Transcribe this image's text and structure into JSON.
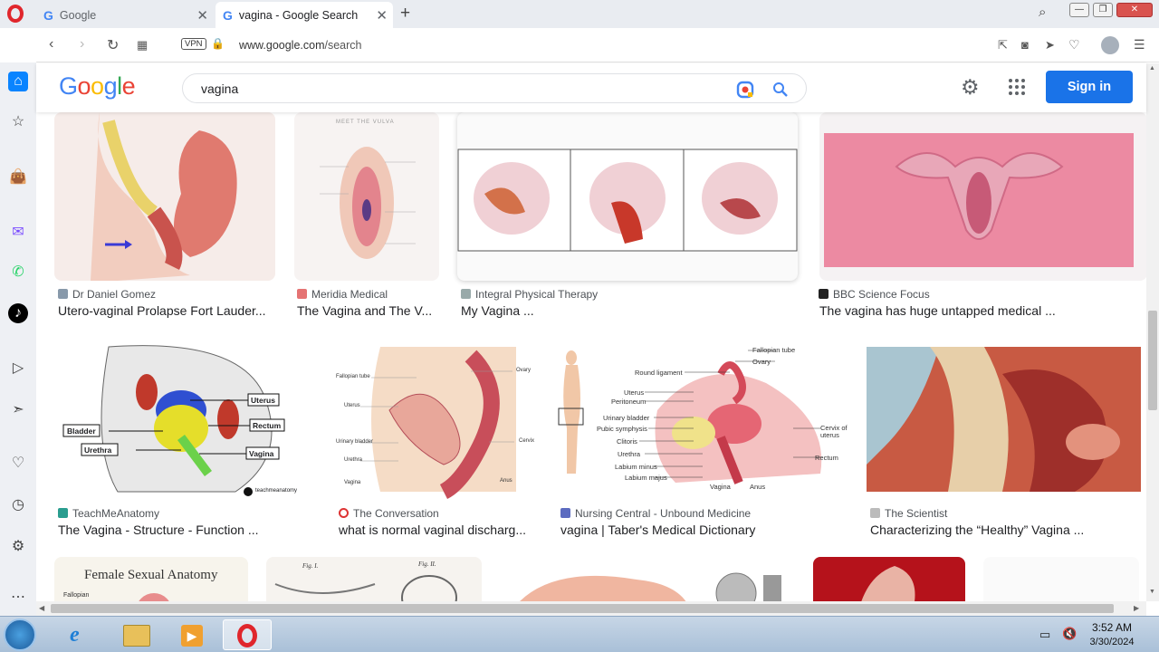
{
  "browser": {
    "tabs": [
      {
        "label": "Google",
        "active": false
      },
      {
        "label": "vagina - Google Search",
        "active": true
      }
    ],
    "vpn_label": "VPN",
    "url_host": "www.google.com",
    "url_path": "/search"
  },
  "google": {
    "logo": "Google",
    "query": "vagina",
    "signin_label": "Sign in"
  },
  "results": [
    {
      "source": "Dr Daniel Gomez",
      "title": "Utero-vaginal Prolapse Fort Lauder..."
    },
    {
      "source": "Meridia Medical",
      "title": "The Vagina and The V..."
    },
    {
      "source": "Integral Physical Therapy",
      "title": "My Vagina ..."
    },
    {
      "source": "BBC Science Focus",
      "title": "The vagina has huge untapped medical ..."
    },
    {
      "source": "TeachMeAnatomy",
      "title": "The Vagina - Structure - Function ..."
    },
    {
      "source": "The Conversation",
      "title": "what is normal vaginal discharg..."
    },
    {
      "source": "Nursing Central - Unbound Medicine",
      "title": "vagina | Taber's Medical Dictionary"
    },
    {
      "source": "The Scientist",
      "title": "Characterizing the “Healthy” Vagina ..."
    }
  ],
  "image_text": {
    "meet_the_vulva": "MEET THE VULVA",
    "uterus": "Uterus",
    "bladder": "Bladder",
    "rectum": "Rectum",
    "urethra": "Urethra",
    "vagina": "Vagina",
    "teachme": "teachmeanatomy",
    "female_sexual_anatomy": "Female Sexual Anatomy",
    "fallopian": "Fallopian",
    "fallopian_tube": "Fallopian tube",
    "ovary": "Ovary",
    "round_ligament": "Round ligament",
    "peritoneum": "Peritoneum",
    "urinary_bladder": "Urinary bladder",
    "pubic_symphysis": "Pubic symphysis",
    "clitoris": "Clitoris",
    "labium_minus": "Labium minus",
    "labium_majus": "Labium majus",
    "anus": "Anus",
    "cervix_of_uterus": "Cervix of uterus",
    "cervix": "Cervix",
    "fig1": "Fig. I.",
    "fig2": "Fig. II."
  },
  "taskbar": {
    "time": "3:52 AM",
    "date": "3/30/2024"
  }
}
